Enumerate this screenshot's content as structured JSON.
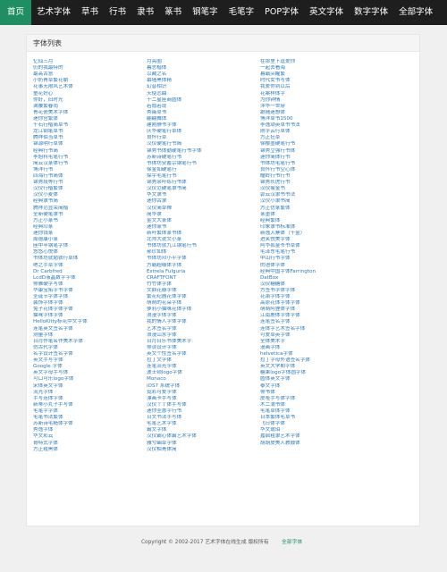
{
  "nav": [
    "首页",
    "艺术字体",
    "草书",
    "行书",
    "隶书",
    "篆书",
    "钢笔字",
    "毛笔字",
    "POP字体",
    "英文字体",
    "数字字体",
    "全部字体"
  ],
  "panel": {
    "title": "字体列表"
  },
  "columns": [
    [
      "忆仙三月",
      "仍的我最特的",
      "最高古意",
      "小奶青草繁花朝",
      "花事无限风艺术体",
      "童花好心",
      "你好，旧时光",
      "满腰繁春雨",
      "青花瓷美术字体",
      "迷你宫繁体",
      "千石行楷简草书",
      "龙江钢笔草书",
      "腾祥伯当草书",
      "锦源明行草体",
      "经典行书简",
      "李旭科毛笔行书",
      "简云汉篆体行书",
      "博洋行书",
      "四海行书简体",
      "锦秀段等行书",
      "汉仪行楷繁体",
      "汉仪小麦体",
      "经典隶书简",
      "腾祥范显荣简楷",
      "全新硬笔隶书",
      "方正小篆书",
      "经典印篆",
      "迷你钱篆",
      "周德康小篆",
      "座中半钢笔字体",
      "悠悠心悦体",
      "书体坊就勉铁行草体",
      "嗯之手草字体",
      "Dr Carbfred",
      "LcdD液晶数字字体",
      "俳雅硬字写体",
      "华康宝拓字书字体",
      "圣诞节字体字体",
      "装饰字体字体",
      "兔子花体字体字体",
      "猫咪字体字体",
      "HelloKitty标花中文字体",
      "连笔英文签名字体",
      "测量字体",
      "日月作笔名作美术字体",
      "仿古代字体",
      "名字设计签名字体",
      "英文手写字体",
      "Google 字体",
      "英文字母手写体",
      "可口可乐logo字体",
      "宋体英文字体",
      "流光字体",
      "手写连体字体",
      "新蒂小丸子手写体",
      "毛笔字字体",
      "毛笔书法繁体",
      "苏新诗毛糙体字体",
      "秀逸字体",
      "华文彩云",
      "哥特式字体",
      "方正粗黑体"
    ],
    [
      "月亮圈",
      "暮志楷体",
      "以藏之名",
      "幕墙黑体精",
      "幻音相识",
      "天使恋曲",
      "十二星座商圆体",
      "若隐若现",
      "秀薇草书",
      "翩翩舞体",
      "建刚静书字体",
      "庆华硬笔行草体",
      "良怀行草",
      "汉仪硬笔行书简",
      "锦秀书体勤硬笔行书字体",
      "苏新诗硬笔行书",
      "书体坊安蓄宗钢笔行书",
      "徐金如硬笔行",
      "探宇毛笔行书",
      "锦秀余叶练行书体",
      "汉仪范硬笔隶书简",
      "华文隶书",
      "迷你古隶",
      "汉仪简草禅",
      "简华隶",
      "金文大篆体",
      "迷你篆书",
      "新叶繁体篆书体",
      "北师大说文小篆",
      "书体坊就九江钢笔行书",
      "郝珍如体",
      "书体坊邓小平字体",
      "方霸超细体字体",
      "Estrela Fulguria",
      "CRAFTFONT",
      "竹竹体字体",
      "文鼎花瓣字体",
      "繁花纪器花体字体",
      "萌萌的花朵字体",
      "萝莉小猫咪花体字体",
      "浪漫字体字体",
      "我的情人字体字体",
      "艺术签名字体",
      "浪漫山水字体",
      "日月日乐书体美术字",
      "俳谈设计字体",
      "英文个性签名字体",
      "拉丁文字体",
      "连笔流光字体",
      "波士顿logo字体",
      "Monaco",
      "iOS7 系统字体",
      "霓彩可爱字体",
      "漂画卡手写体",
      "汉仪丫丫体手写体",
      "迷你圣愚字行书",
      "日文书法手写体",
      "毛笔艺术字体",
      "霸文字体",
      "汉仪霸心体霸艺术字体",
      "雅兮幽草字体",
      "汉仪柏青体简"
    ],
    [
      "在那里下逗爱你",
      "一起去看海",
      "暮霸突醒繁",
      "时代女书写体",
      "我爱你到以后",
      "花案样体字",
      "为你钟情",
      "萍华一世穿",
      "跟随迷想体",
      "博洋草书1500",
      "李逸顽英草书书法",
      "刚字云行草体",
      "方正狂草",
      "徐樱墨硬笔行书",
      "锦秀立强行书体",
      "迷你简体行书",
      "书体坊毛笔行书",
      "良怀行书空心体",
      "瞳岭行书行书",
      "锦秀长虎行书",
      "汉仪瘦金书",
      "郭云汉隶书书法",
      "汉仪小隶书简",
      "方正仿篆繁体",
      "篆墨体",
      "经典繁体",
      "印象隶书标准体",
      "新逸入寨体（千金）",
      "进笑悦美字体",
      "阿华孤金爷书草体",
      "毛泽东毛笔行书",
      "中山行书字体",
      "的语体字体",
      "经典中国字体Farrington",
      "DatBox",
      "汉仪糖糖体",
      "方签书字体字体",
      "花萧字体字体",
      "高原花体字体字体",
      "萌萌阿狸体字体",
      "江南鹿体字体字体",
      "连笔签名字体",
      "连体字艺术签名字体",
      "可爱草英字体",
      "全体美术字",
      "漫画字体",
      "helvetica字体",
      "拉丁字母外语签名字体",
      "英文大学期字体",
      "糖果logo字体圆字体",
      "圆体英文字体",
      "泰文字体",
      "俳书体",
      "皮哑手写体字体",
      "木二蒲书体",
      "毛笔草体字体",
      "日本繁体毛草书",
      "飞日体字体",
      "华文琥珀",
      "嘉启粗隶艺术字体",
      "胡胡皮美人教鼓体"
    ]
  ],
  "footer": {
    "copyright": "Copyright © 2002-2017 艺术字体在线生成 版权所有",
    "link": "全部字体"
  }
}
